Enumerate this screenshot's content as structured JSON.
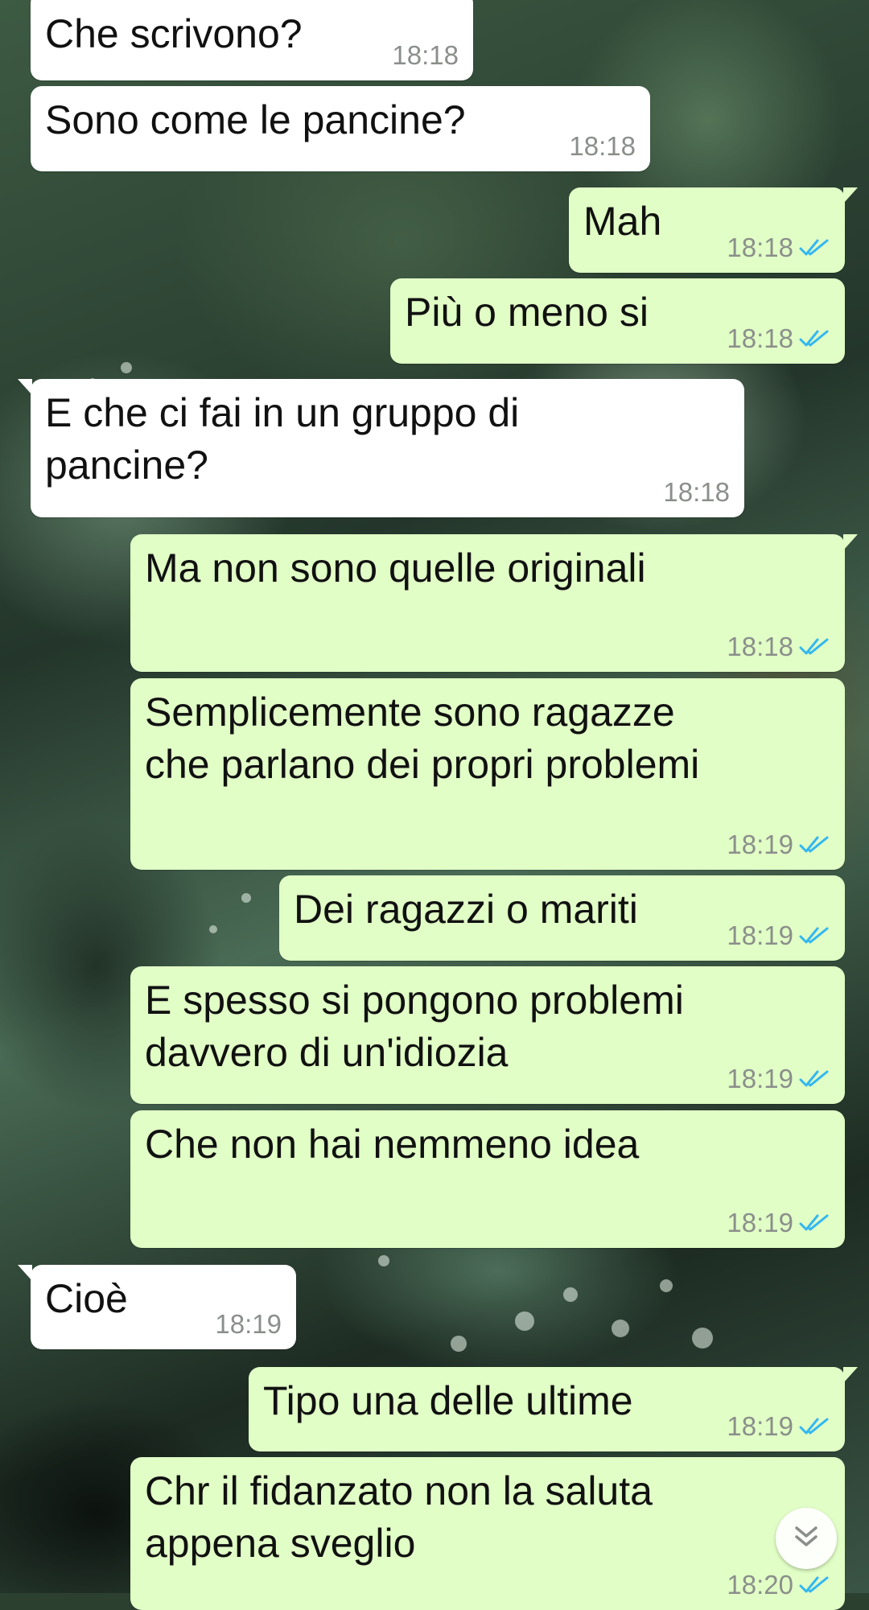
{
  "messages": [
    {
      "direction": "incoming",
      "text": "Che scrivono?",
      "time": "18:18"
    },
    {
      "direction": "incoming",
      "text": "Sono come le pancine?",
      "time": "18:18"
    },
    {
      "direction": "outgoing",
      "text": "Mah",
      "time": "18:18",
      "status": "read"
    },
    {
      "direction": "outgoing",
      "text": "Più o meno si",
      "time": "18:18",
      "status": "read"
    },
    {
      "direction": "incoming",
      "text": "E che ci fai in un gruppo di\npancine?",
      "time": "18:18"
    },
    {
      "direction": "outgoing",
      "text": "Ma non sono quelle originali",
      "time": "18:18",
      "status": "read"
    },
    {
      "direction": "outgoing",
      "text": "Semplicemente sono ragazze\nche parlano dei propri problemi",
      "time": "18:19",
      "status": "read"
    },
    {
      "direction": "outgoing",
      "text": "Dei ragazzi o mariti",
      "time": "18:19",
      "status": "read"
    },
    {
      "direction": "outgoing",
      "text": "E spesso si pongono problemi\ndavvero di un'idiozia",
      "time": "18:19",
      "status": "read"
    },
    {
      "direction": "outgoing",
      "text": "Che non hai nemmeno idea",
      "time": "18:19",
      "status": "read"
    },
    {
      "direction": "incoming",
      "text": "Cioè",
      "time": "18:19"
    },
    {
      "direction": "outgoing",
      "text": "Tipo una delle ultime",
      "time": "18:19",
      "status": "read"
    },
    {
      "direction": "outgoing",
      "text": "Chr il fidanzato non la saluta\nappena sveglio",
      "time": "18:20",
      "status": "read"
    }
  ],
  "colors": {
    "incoming_bubble": "#ffffff",
    "outgoing_bubble": "#e1fec6",
    "read_ticks": "#34b7f1",
    "timestamp": "#8b8f8b"
  },
  "icons": {
    "read_receipt": "double-check-icon",
    "scroll_down": "double-chevron-down-icon"
  }
}
